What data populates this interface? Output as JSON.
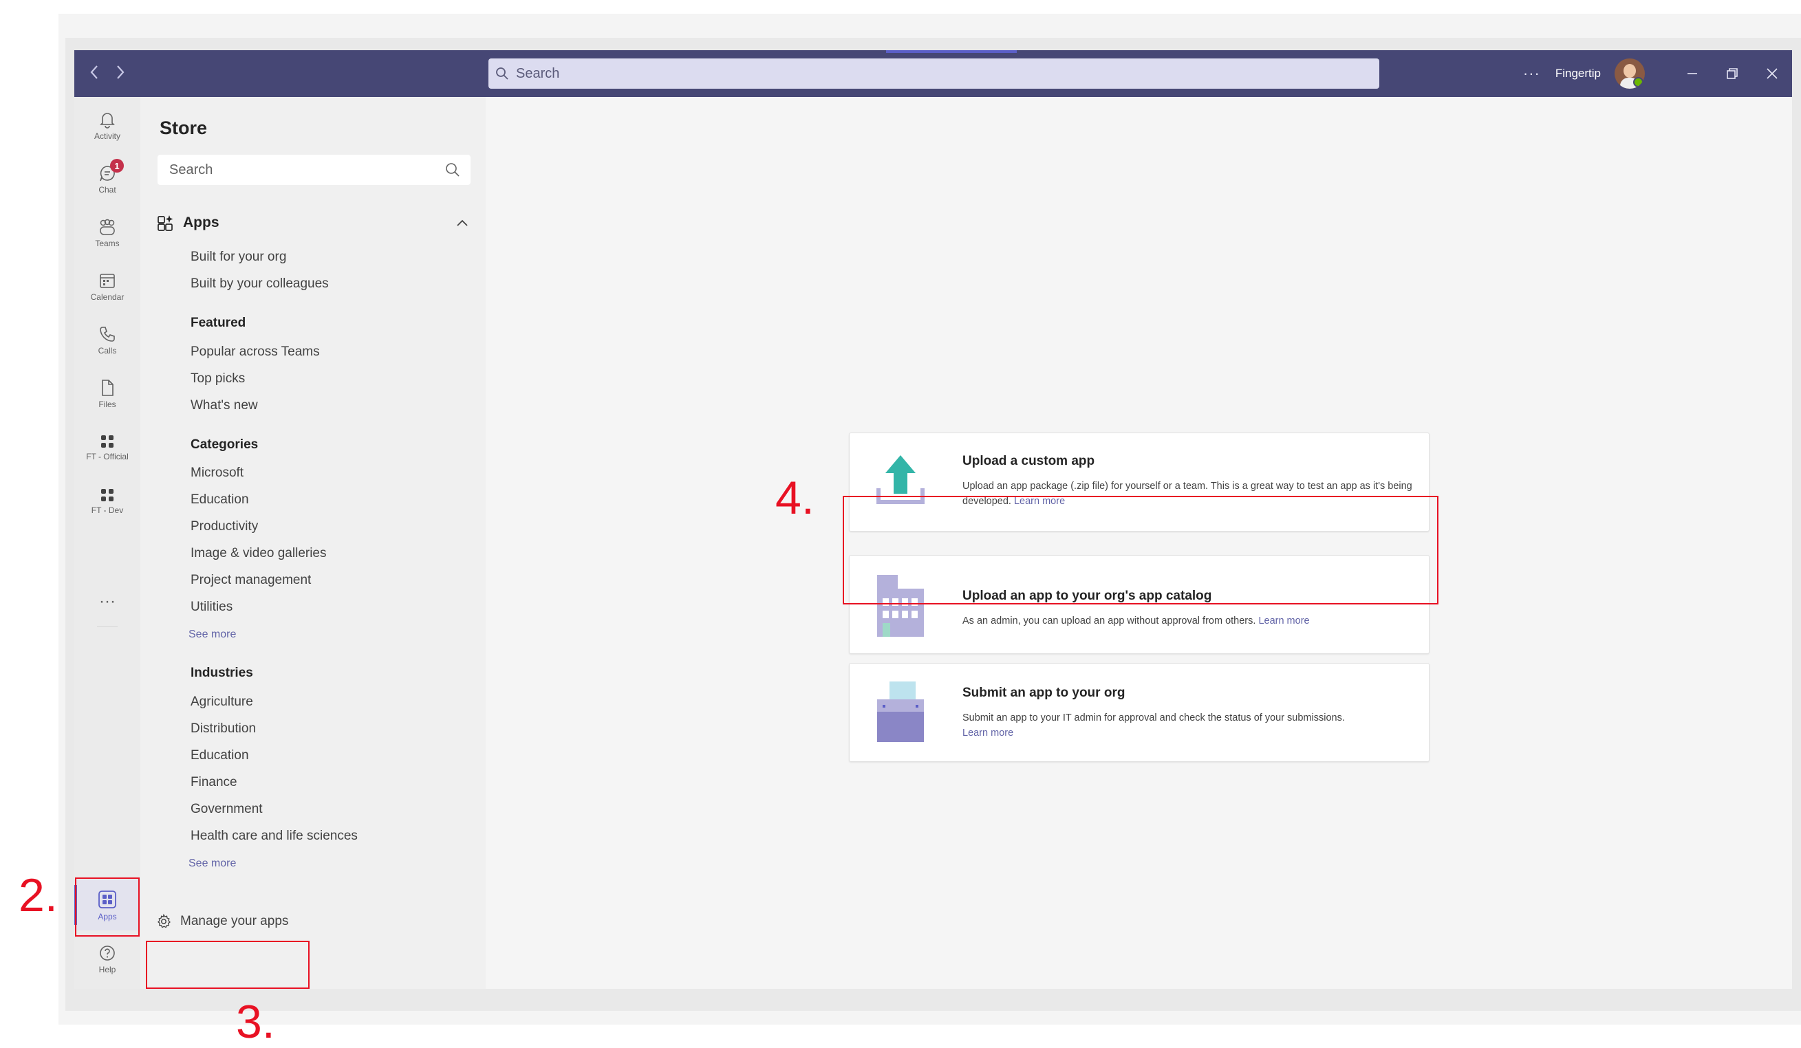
{
  "titlebar": {
    "search_placeholder": "Search",
    "more_label": "···",
    "user_name": "Fingertip"
  },
  "rail": {
    "items": [
      {
        "label": "Activity"
      },
      {
        "label": "Chat",
        "badge": "1"
      },
      {
        "label": "Teams"
      },
      {
        "label": "Calendar"
      },
      {
        "label": "Calls"
      },
      {
        "label": "Files"
      },
      {
        "label": "FT - Official"
      },
      {
        "label": "FT - Dev"
      }
    ],
    "more": "···",
    "apps_label": "Apps",
    "help_label": "Help"
  },
  "store": {
    "title": "Store",
    "search_placeholder": "Search",
    "apps_section": "Apps",
    "org_links": [
      "Built for your org",
      "Built by your colleagues"
    ],
    "featured": {
      "heading": "Featured",
      "items": [
        "Popular across Teams",
        "Top picks",
        "What's new"
      ]
    },
    "categories": {
      "heading": "Categories",
      "items": [
        "Microsoft",
        "Education",
        "Productivity",
        "Image & video galleries",
        "Project management",
        "Utilities"
      ],
      "see_more": "See more"
    },
    "industries": {
      "heading": "Industries",
      "items": [
        "Agriculture",
        "Distribution",
        "Education",
        "Finance",
        "Government",
        "Health care and life sciences"
      ],
      "see_more": "See more"
    },
    "manage_label": "Manage your apps"
  },
  "cards": [
    {
      "title": "Upload a custom app",
      "desc": "Upload an app package (.zip file) for yourself or a team. This is a great way to test an app as it's being developed.",
      "link": "Learn more"
    },
    {
      "title": "Upload an app to your org's app catalog",
      "desc": "As an admin, you can upload an app without approval from others.",
      "link": "Learn more"
    },
    {
      "title": "Submit an app to your org",
      "desc": "Submit an app to your IT admin for approval and check the status of your submissions.",
      "link": "Learn more"
    }
  ],
  "annotations": {
    "step2": "2.",
    "step3": "3.",
    "step4": "4."
  },
  "colors": {
    "titlebar": "#464775",
    "accent": "#5b5fc7",
    "link": "#6264a7",
    "annotation": "#e81123",
    "upload_icon": "#33b5a8",
    "building_icon": "#b4b1db"
  }
}
